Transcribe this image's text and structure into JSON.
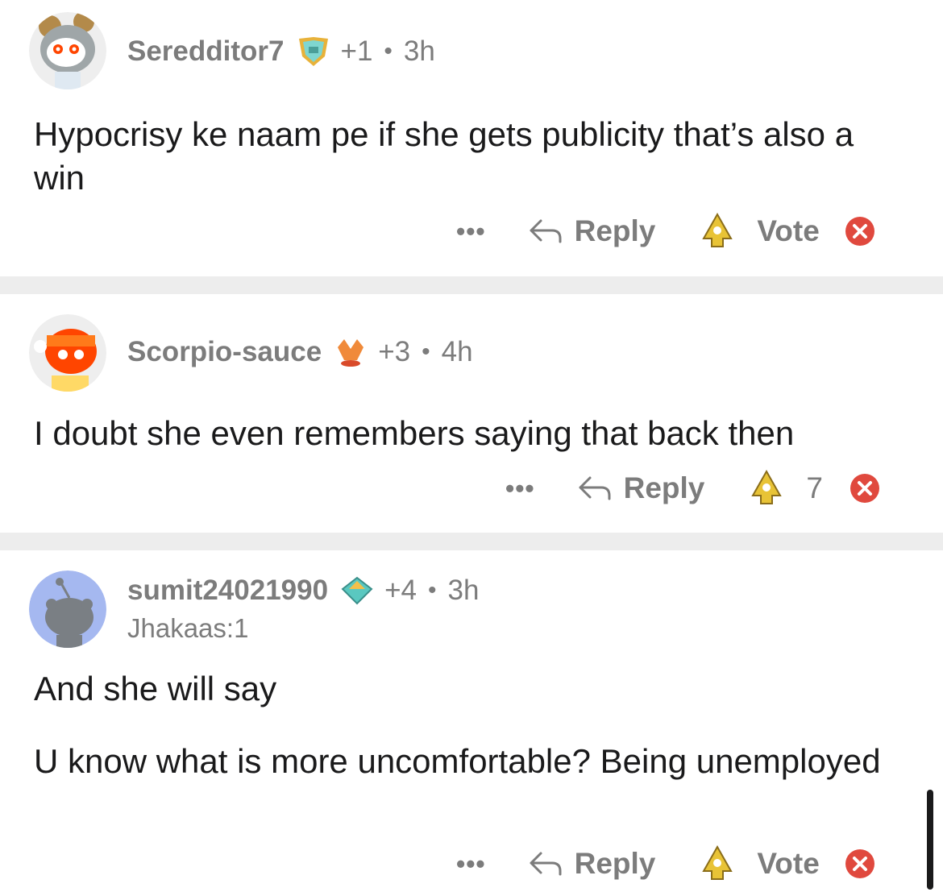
{
  "comments": [
    {
      "username": "Seredditor7",
      "karma": "+1",
      "separator": "•",
      "age": "3h",
      "body": [
        "Hypocrisy ke naam pe if she gets publicity that’s also a win"
      ],
      "more": "•••",
      "reply_label": "Reply",
      "vote_label": "Vote"
    },
    {
      "username": "Scorpio-sauce",
      "karma": "+3",
      "separator": "•",
      "age": "4h",
      "body": [
        "I doubt she even remembers saying that back then"
      ],
      "more": "•••",
      "reply_label": "Reply",
      "vote_label": "7"
    },
    {
      "username": "sumit24021990",
      "flair": "Jhakaas:1",
      "karma": "+4",
      "separator": "•",
      "age": "3h",
      "body": [
        "And she will say",
        "U know what is more uncomfortable? Being unemployed"
      ],
      "more": "•••",
      "reply_label": "Reply",
      "vote_label": "Vote"
    }
  ],
  "colors": {
    "meta_gray": "#7c7c7c",
    "text": "#1a1a1b",
    "divider": "#ededed",
    "downvote_red": "#e0493e",
    "upvote_gold": "#e8c336",
    "avatar_blue": "#a5b8f0"
  }
}
